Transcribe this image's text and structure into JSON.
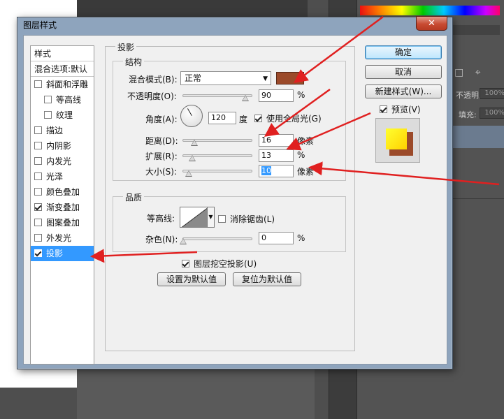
{
  "colors": {
    "shadow_color": "#9b4a2a",
    "selection": "#3399ff",
    "annotation_arrow": "#e02020"
  },
  "dialog": {
    "title": "图层样式",
    "close_glyph": "✕"
  },
  "style_list": {
    "header": "样式",
    "blend_options": "混合选项:默认",
    "items": [
      {
        "label": "斜面和浮雕",
        "checked": false,
        "sub": false,
        "selected": false
      },
      {
        "label": "等高线",
        "checked": false,
        "sub": true,
        "selected": false
      },
      {
        "label": "纹理",
        "checked": false,
        "sub": true,
        "selected": false
      },
      {
        "label": "描边",
        "checked": false,
        "sub": false,
        "selected": false
      },
      {
        "label": "内阴影",
        "checked": false,
        "sub": false,
        "selected": false
      },
      {
        "label": "内发光",
        "checked": false,
        "sub": false,
        "selected": false
      },
      {
        "label": "光泽",
        "checked": false,
        "sub": false,
        "selected": false
      },
      {
        "label": "颜色叠加",
        "checked": false,
        "sub": false,
        "selected": false
      },
      {
        "label": "渐变叠加",
        "checked": true,
        "sub": false,
        "selected": false
      },
      {
        "label": "图案叠加",
        "checked": false,
        "sub": false,
        "selected": false
      },
      {
        "label": "外发光",
        "checked": false,
        "sub": false,
        "selected": false
      },
      {
        "label": "投影",
        "checked": true,
        "sub": false,
        "selected": true
      }
    ]
  },
  "drop_shadow": {
    "group_title": "投影",
    "structure": {
      "title": "结构",
      "blend_mode_label": "混合模式(B):",
      "blend_mode_value": "正常",
      "opacity_label": "不透明度(O):",
      "opacity_value": "90",
      "opacity_fraction": 0.9,
      "opacity_unit": "%",
      "angle_label": "角度(A):",
      "angle_value": "120",
      "angle_unit": "度",
      "global_light_label": "使用全局光(G)",
      "global_light_checked": true,
      "distance_label": "距离(D):",
      "distance_value": "16",
      "distance_unit": "像素",
      "spread_label": "扩展(R):",
      "spread_value": "13",
      "spread_unit": "%",
      "size_label": "大小(S):",
      "size_value": "10",
      "size_unit": "像素"
    },
    "quality": {
      "title": "品质",
      "contour_label": "等高线:",
      "anti_alias_label": "消除锯齿(L)",
      "anti_alias_checked": false,
      "noise_label": "杂色(N):",
      "noise_value": "0",
      "noise_unit": "%"
    },
    "knockout_label": "图层挖空投影(U)",
    "knockout_checked": true,
    "make_default": "设置为默认值",
    "reset_default": "复位为默认值"
  },
  "actions": {
    "ok": "确定",
    "cancel": "取消",
    "new_style": "新建样式(W)...",
    "preview_label": "预览(V)",
    "preview_checked": true
  },
  "background_panel": {
    "opacity_label": "不透明度:",
    "opacity_value": "100%",
    "fill_label": "填充:",
    "fill_value": "100%"
  }
}
